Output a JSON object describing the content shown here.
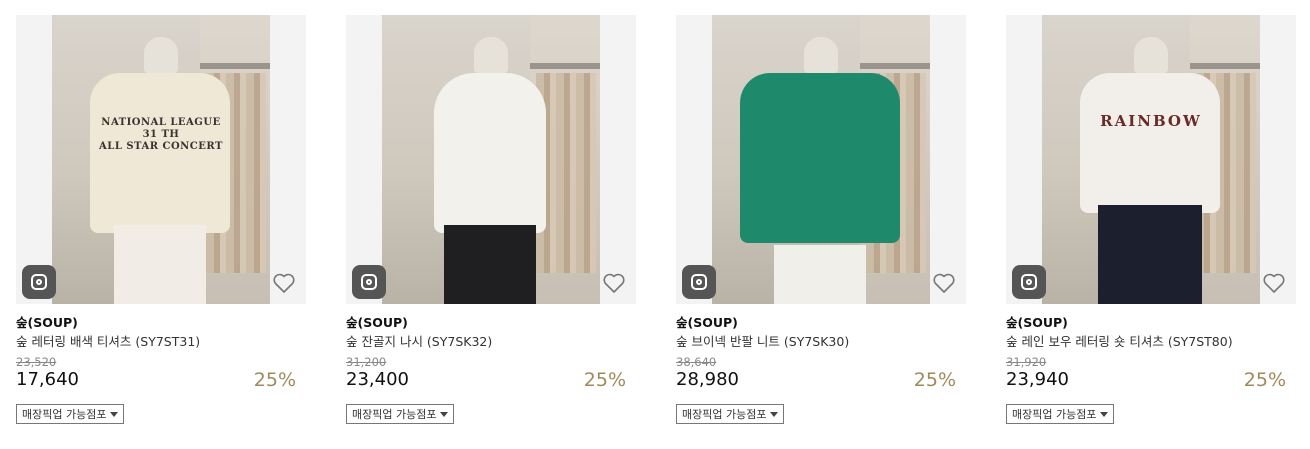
{
  "products": [
    {
      "brand": "숲(SOUP)",
      "name": "숲 레터링 배색 티셔츠 (SY7ST31)",
      "original_price": "23,520",
      "price": "17,640",
      "discount": "25%",
      "pickup_label": "매장픽업 가능점포",
      "print_text": "NATIONAL LEAGUE\n31 TH\nALL STAR CONCERT",
      "garment_color": "#efe8d6",
      "bottom_color": "#f1ede6"
    },
    {
      "brand": "숲(SOUP)",
      "name": "숲 잔골지 나시 (SY7SK32)",
      "original_price": "31,200",
      "price": "23,400",
      "discount": "25%",
      "pickup_label": "매장픽업 가능점포",
      "print_text": "",
      "garment_color": "#f3f1ec",
      "bottom_color": "#1f1f22"
    },
    {
      "brand": "숲(SOUP)",
      "name": "숲 브이넥 반팔 니트 (SY7SK30)",
      "original_price": "38,640",
      "price": "28,980",
      "discount": "25%",
      "pickup_label": "매장픽업 가능점포",
      "print_text": "",
      "garment_color": "#1f8a6b",
      "bottom_color": "#f1efea"
    },
    {
      "brand": "숲(SOUP)",
      "name": "숲 레인 보우 레터링 숏 티셔츠 (SY7ST80)",
      "original_price": "31,920",
      "price": "23,940",
      "discount": "25%",
      "pickup_label": "매장픽업 가능점포",
      "print_text": "RAINBOW",
      "garment_color": "#f2efea",
      "bottom_color": "#1c1f2e"
    }
  ],
  "icons": {
    "instagram": "instagram-icon",
    "wishlist": "heart-icon",
    "dropdown": "caret-down-icon"
  },
  "colors": {
    "discount": "#a08a5c",
    "icon_badge": "#555555"
  }
}
